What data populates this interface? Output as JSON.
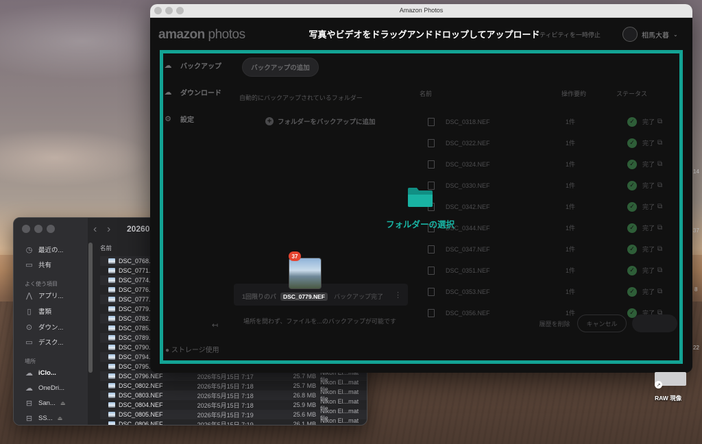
{
  "finder": {
    "path": "20260",
    "column_name": "名前",
    "sidebar": {
      "recent": "最近の...",
      "shared": "共有",
      "favorites_heading": "よく使う項目",
      "apps": "アプリ...",
      "documents": "書類",
      "downloads": "ダウン...",
      "desktop": "デスク...",
      "locations_heading": "場所",
      "icloud": "iClo...",
      "onedrive": "OneDri...",
      "drive1": "San...",
      "drive2": "SS..."
    },
    "files": [
      {
        "name": "DSC_0768.NEF",
        "date": "",
        "size": "",
        "kind": ""
      },
      {
        "name": "DSC_0771.NEF",
        "date": "",
        "size": "",
        "kind": ""
      },
      {
        "name": "DSC_0774.NEF",
        "date": "",
        "size": "",
        "kind": ""
      },
      {
        "name": "DSC_0776.NEF",
        "date": "",
        "size": "",
        "kind": ""
      },
      {
        "name": "DSC_0777.NEF",
        "date": "",
        "size": "",
        "kind": ""
      },
      {
        "name": "DSC_0779.NEF",
        "date": "",
        "size": "",
        "kind": ""
      },
      {
        "name": "DSC_0782.NEF",
        "date": "",
        "size": "",
        "kind": ""
      },
      {
        "name": "DSC_0785.NEF",
        "date": "",
        "size": "",
        "kind": ""
      },
      {
        "name": "DSC_0789.NEF",
        "date": "",
        "size": "",
        "kind": ""
      },
      {
        "name": "DSC_0790.NEF",
        "date": "",
        "size": "",
        "kind": ""
      },
      {
        "name": "DSC_0794.NEF",
        "date": "",
        "size": "",
        "kind": ""
      },
      {
        "name": "DSC_0795.NEF",
        "date": "",
        "size": "",
        "kind": ""
      },
      {
        "name": "DSC_0796.NEF",
        "date": "2026年5月15日 7:17",
        "size": "25.7 MB",
        "kind": "Nikon El...mat file"
      },
      {
        "name": "DSC_0802.NEF",
        "date": "2026年5月15日 7:18",
        "size": "25.7 MB",
        "kind": "Nikon El...mat file"
      },
      {
        "name": "DSC_0803.NEF",
        "date": "2026年5月15日 7:18",
        "size": "26.8 MB",
        "kind": "Nikon El...mat file"
      },
      {
        "name": "DSC_0804.NEF",
        "date": "2026年5月15日 7:18",
        "size": "25.9 MB",
        "kind": "Nikon El...mat file"
      },
      {
        "name": "DSC_0805.NEF",
        "date": "2026年5月15日 7:19",
        "size": "25.6 MB",
        "kind": "Nikon El...mat file"
      },
      {
        "name": "DSC_0806.NEF",
        "date": "2026年5月15日 7:19",
        "size": "26.1 MB",
        "kind": "Nikon El...mat file"
      }
    ]
  },
  "amazon": {
    "window_title": "Amazon Photos",
    "logo_a": "amazon",
    "logo_b": "photos",
    "drop_title": "写真やビデオをドラッグアンドドロップしてアップロード",
    "pause_label": "ティビティを一時停止",
    "user_name": "相馬大暮",
    "nav": {
      "backup": "バックアップ",
      "download": "ダウンロード",
      "settings": "設定"
    },
    "add_backup_button": "バックアップの追加",
    "auto_folders_label": "自動的にバックアップされているフォルダー",
    "add_folder_label": "フォルダーをバックアップに追加",
    "card_title": "1回限りのバ",
    "card_status": "バックアップ完了",
    "note": "場所を問わず、ファイルを...のバックアップが可能です",
    "storage_label": "ストレージ使用",
    "table_headers": {
      "name": "名前",
      "count": "操作要約",
      "status": "ステータス"
    },
    "rows": [
      {
        "name": "DSC_0318.NEF",
        "count": "1件",
        "status": "完了"
      },
      {
        "name": "DSC_0322.NEF",
        "count": "1件",
        "status": "完了"
      },
      {
        "name": "DSC_0324.NEF",
        "count": "1件",
        "status": "完了"
      },
      {
        "name": "DSC_0330.NEF",
        "count": "1件",
        "status": "完了"
      },
      {
        "name": "DSC_0342.NEF",
        "count": "1件",
        "status": "完了"
      },
      {
        "name": "DSC_0344.NEF",
        "count": "1件",
        "status": "完了"
      },
      {
        "name": "DSC_0347.NEF",
        "count": "1件",
        "status": "完了"
      },
      {
        "name": "DSC_0351.NEF",
        "count": "1件",
        "status": "完了"
      },
      {
        "name": "DSC_0353.NEF",
        "count": "1件",
        "status": "完了"
      },
      {
        "name": "DSC_0356.NEF",
        "count": "1件",
        "status": "完了"
      }
    ],
    "clear_history": "履歴を削除",
    "cancel": "キャンセル",
    "overlay_label": "フォルダーの選択",
    "accent_color": "#13a394"
  },
  "drag": {
    "badge": "37",
    "filename": "DSC_0779.NEF"
  },
  "desktop": {
    "icon_label": "RAW 現像",
    "edge_numbers": [
      "14",
      "37",
      "8",
      "22"
    ]
  }
}
